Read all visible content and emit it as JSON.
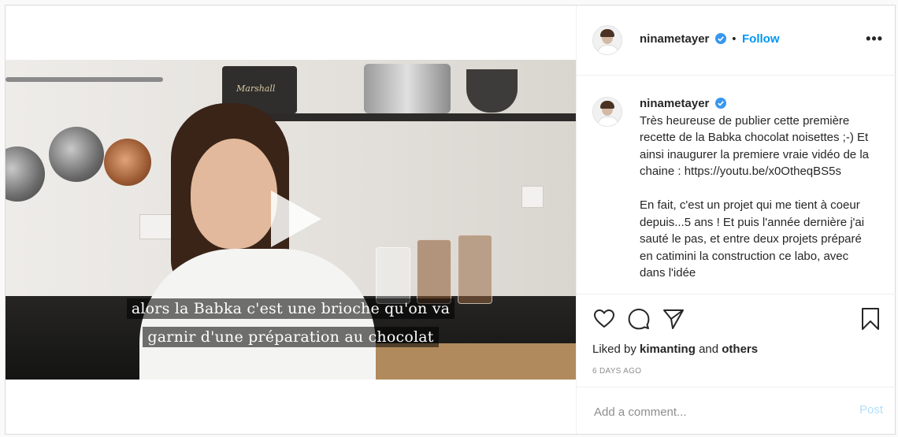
{
  "video": {
    "subtitle_line1": "alors la Babka c'est une brioche qu'on va",
    "subtitle_line2": "garnir d'une préparation au chocolat",
    "brand_on_speaker": "Marshall"
  },
  "header": {
    "username": "ninametayer",
    "separator": "•",
    "follow_label": "Follow",
    "more_label": "•••"
  },
  "caption": {
    "username": "ninametayer",
    "paragraph1": "Très heureuse de publier cette première recette de la Babka chocolat noisettes ;-) Et ainsi inaugurer la premiere vraie vidéo de la chaine : https://youtu.be/x0OtheqBS5s",
    "paragraph2": "En fait, c'est un projet qui me tient à coeur depuis...5 ans ! Et puis l'année dernière j'ai sauté le pas, et entre deux projets préparé en catimini la construction ce labo, avec dans l'idée"
  },
  "engagement": {
    "liked_by_prefix": "Liked by",
    "liked_by_user": "kimanting",
    "liked_by_and": "and",
    "liked_by_others": "others",
    "date": "6 DAYS AGO"
  },
  "comment": {
    "placeholder": "Add a comment...",
    "post_label": "Post"
  },
  "colors": {
    "accent": "#0095f6",
    "post_disabled": "#b2dffc",
    "secondary_text": "#8e8e8e"
  },
  "icons": [
    "verified-badge-icon",
    "heart-icon",
    "comment-icon",
    "share-icon",
    "bookmark-icon",
    "more-icon",
    "play-icon"
  ]
}
